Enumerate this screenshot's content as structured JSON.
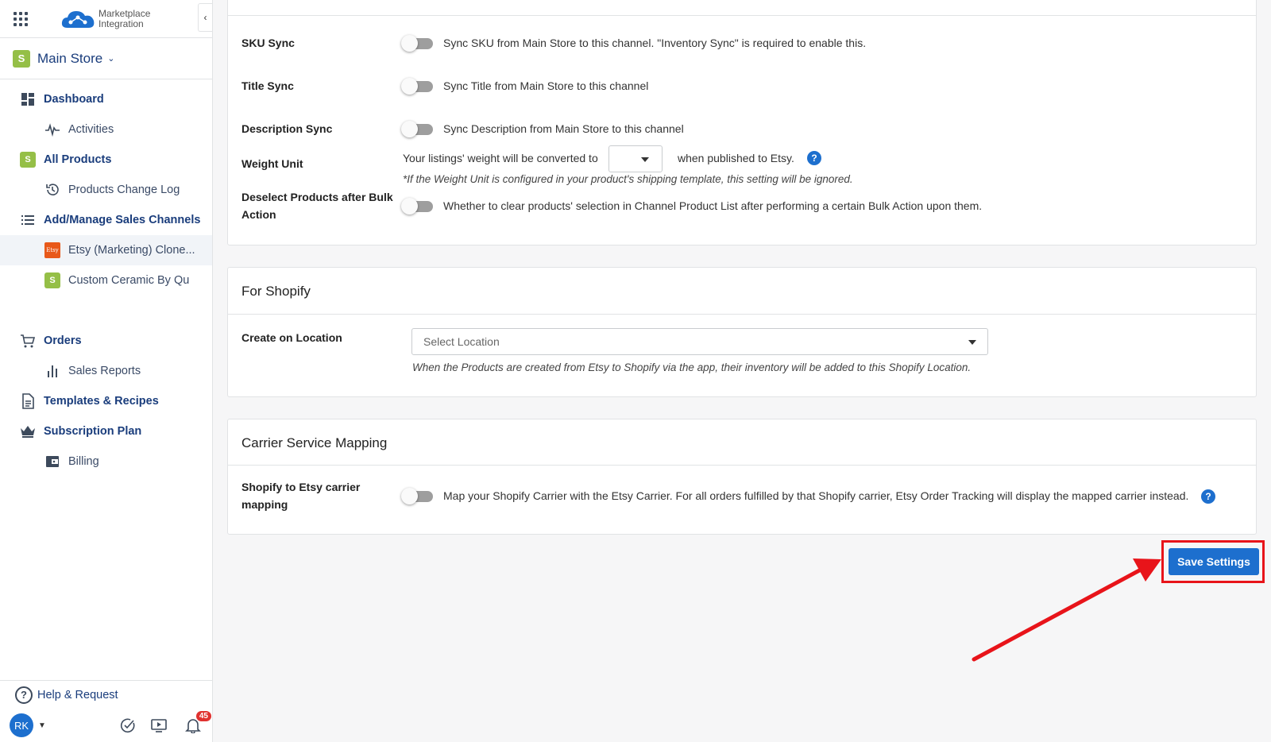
{
  "app": {
    "name_line1": "Marketplace",
    "name_line2": "Integration"
  },
  "store": {
    "name": "Main Store"
  },
  "nav": [
    {
      "label": "Dashboard"
    },
    {
      "label": "Activities"
    },
    {
      "label": "All Products"
    },
    {
      "label": "Products Change Log"
    },
    {
      "label": "Add/Manage Sales Channels"
    },
    {
      "label": "Etsy (Marketing) Clone..."
    },
    {
      "label": "Custom Ceramic By Qu"
    },
    {
      "label": "Orders"
    },
    {
      "label": "Sales Reports"
    },
    {
      "label": "Templates & Recipes"
    },
    {
      "label": "Subscription Plan"
    },
    {
      "label": "Billing"
    }
  ],
  "etsy_badge": "Etsy",
  "help": {
    "label": "Help & Request"
  },
  "user": {
    "initials": "RK",
    "notification_count": "45"
  },
  "settings": {
    "sku_sync": {
      "label": "SKU Sync",
      "desc": "Sync SKU from Main Store to this channel. \"Inventory Sync\" is required to enable this."
    },
    "title_sync": {
      "label": "Title Sync",
      "desc": "Sync Title from Main Store to this channel"
    },
    "description_sync": {
      "label": "Description Sync",
      "desc": "Sync Description from Main Store to this channel"
    },
    "weight_unit": {
      "label": "Weight Unit",
      "desc_before": "Your listings' weight will be converted to",
      "desc_after": "when published to Etsy.",
      "note": "*If the Weight Unit is configured in your product's shipping template, this setting will be ignored."
    },
    "deselect": {
      "label_line1": "Deselect Products after Bulk",
      "label_line2": "Action",
      "desc": "Whether to clear products' selection in Channel Product List after performing a certain Bulk Action upon them."
    }
  },
  "shopify": {
    "title": "For Shopify",
    "location_label": "Create on Location",
    "location_placeholder": "Select Location",
    "location_note": "When the Products are created from Etsy to Shopify via the app, their inventory will be added to this Shopify Location."
  },
  "carrier": {
    "title": "Carrier Service Mapping",
    "label_line1": "Shopify to Etsy carrier",
    "label_line2": "mapping",
    "desc": "Map your Shopify Carrier with the Etsy Carrier. For all orders fulfilled by that Shopify carrier, Etsy Order Tracking will display the mapped carrier instead."
  },
  "actions": {
    "save_label": "Save Settings"
  },
  "colors": {
    "primary": "#1d6fce",
    "highlight": "#e8141a",
    "nav_text": "#1a3d7c"
  }
}
